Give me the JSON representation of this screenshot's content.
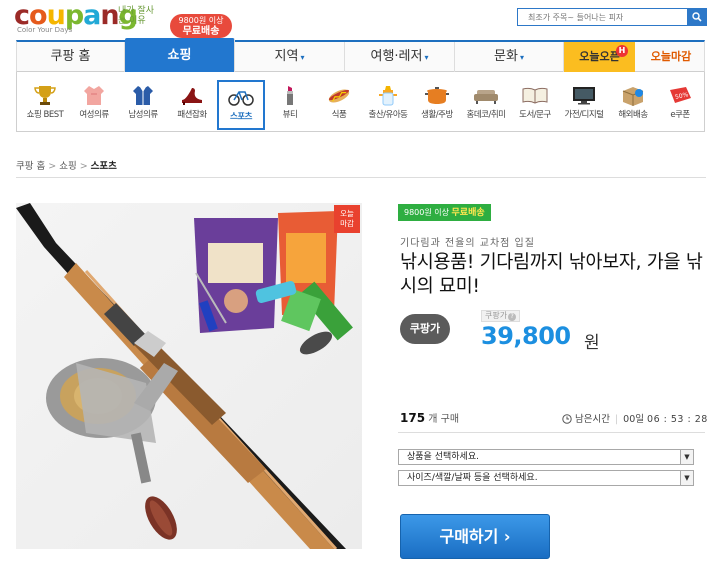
{
  "header": {
    "logo_letters": [
      "c",
      "o",
      "u",
      "p",
      "a",
      "n",
      "g"
    ],
    "logo_colors": [
      "#9b2a27",
      "#e55a1c",
      "#f5b600",
      "#7cb82f",
      "#22a9d6",
      "#9b2a27",
      "#7cb82f"
    ],
    "logo_tagline": "Color Your Days",
    "slogan": "내가 잘사는 이유",
    "free_ship_top": "9800원 이상",
    "free_ship_bottom": "무료배송",
    "search_placeholder": "최조가 주목~ 들어나는 피자"
  },
  "gnb": {
    "tabs": [
      {
        "label": "쿠팡 홈",
        "arrow": ""
      },
      {
        "label": "쇼핑",
        "arrow": ""
      },
      {
        "label": "지역",
        "arrow": "▾"
      },
      {
        "label": "여행·레저",
        "arrow": "▾"
      },
      {
        "label": "문화",
        "arrow": "▾"
      }
    ],
    "today_open": "오늘오픈",
    "today_badge": "H",
    "today_deadline": "오늘마감"
  },
  "categories": [
    {
      "label": "쇼핑 BEST",
      "icon": "trophy-icon"
    },
    {
      "label": "여성의류",
      "icon": "blouse-icon"
    },
    {
      "label": "남성의류",
      "icon": "shirt-icon"
    },
    {
      "label": "패션잡화",
      "icon": "heel-icon"
    },
    {
      "label": "스포츠",
      "icon": "bicycle-icon"
    },
    {
      "label": "뷰티",
      "icon": "lipstick-icon"
    },
    {
      "label": "식품",
      "icon": "hotdog-icon"
    },
    {
      "label": "출산/유아동",
      "icon": "baby-bottle-icon"
    },
    {
      "label": "생활/주방",
      "icon": "pot-icon"
    },
    {
      "label": "홈데코/취미",
      "icon": "sofa-icon"
    },
    {
      "label": "도서/문구",
      "icon": "book-icon"
    },
    {
      "label": "가전/디지털",
      "icon": "tv-icon"
    },
    {
      "label": "해외배송",
      "icon": "box-icon"
    },
    {
      "label": "e쿠폰",
      "icon": "coupon-icon"
    }
  ],
  "breadcrumb": {
    "items": [
      "쿠팡 홈",
      "쇼핑",
      "스포츠"
    ],
    "separator": ">"
  },
  "product": {
    "image_badge": "오늘\n마감",
    "ship_tag_prefix": "9800원 이상",
    "ship_tag_main": "무료배송",
    "subtitle": "기다림과 전율의 교차점 입질",
    "title": "낚시용품! 기다림까지 낚아보자, 가을 낚시의 묘미!",
    "price_badge": "쿠팡가",
    "price_label": "쿠팡가",
    "price": "39,800",
    "price_unit": "원",
    "sold_count": "175",
    "sold_label": "개 구매",
    "remaining_label": "남은시간",
    "remaining_days": "00일",
    "remaining_time": "06 : 53 : 28",
    "select_product": "상품을 선택하세요.",
    "select_option": "사이즈/색깔/날짜 등을 선택하세요.",
    "buy_label": "구매하기 ›"
  }
}
